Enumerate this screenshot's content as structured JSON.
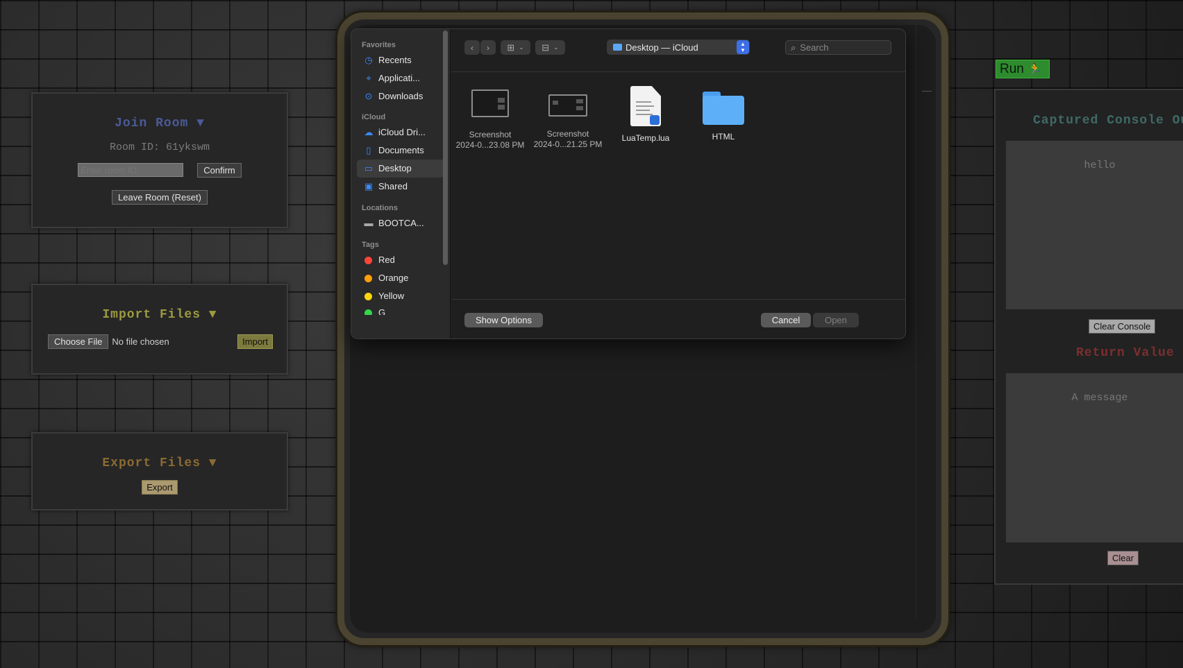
{
  "join_room": {
    "title": "Join Room ▼",
    "room_id_label": "Room ID: 61ykswm",
    "input_placeholder": "Enter room ID",
    "confirm_label": "Confirm",
    "leave_label": "Leave Room (Reset)"
  },
  "import_files": {
    "title": "Import Files ▼",
    "choose_file_label": "Choose File",
    "file_status": "No file chosen",
    "import_label": "Import"
  },
  "export_files": {
    "title": "Export Files ▼",
    "export_label": "Export"
  },
  "dialog": {
    "sidebar": {
      "favorites_heading": "Favorites",
      "favorites": [
        {
          "label": "Recents",
          "icon": "clock-icon"
        },
        {
          "label": "Applicati...",
          "icon": "applications-icon"
        },
        {
          "label": "Downloads",
          "icon": "download-icon"
        }
      ],
      "icloud_heading": "iCloud",
      "icloud": [
        {
          "label": "iCloud Dri...",
          "icon": "cloud-icon"
        },
        {
          "label": "Documents",
          "icon": "document-icon"
        },
        {
          "label": "Desktop",
          "icon": "desktop-icon"
        },
        {
          "label": "Shared",
          "icon": "shared-folder-icon"
        }
      ],
      "locations_heading": "Locations",
      "locations": [
        {
          "label": "BOOTCA...",
          "icon": "disk-icon"
        }
      ],
      "tags_heading": "Tags",
      "tags": [
        {
          "label": "Red",
          "color": "#ff453a"
        },
        {
          "label": "Orange",
          "color": "#ff9f0a"
        },
        {
          "label": "Yellow",
          "color": "#ffd60a"
        },
        {
          "label": "G",
          "color": "#32d74b"
        }
      ]
    },
    "location": "Desktop — iCloud",
    "search_placeholder": "Search",
    "files": [
      {
        "name_line1": "Screenshot",
        "name_line2": "2024-0...23.08 PM",
        "icon": "screenshot-icon"
      },
      {
        "name_line1": "Screenshot",
        "name_line2": "2024-0...21.25 PM",
        "icon": "screenshot-icon"
      },
      {
        "name_line1": "LuaTemp.lua",
        "name_line2": "",
        "icon": "lua-file-icon"
      },
      {
        "name_line1": "HTML",
        "name_line2": "",
        "icon": "folder-icon"
      }
    ],
    "show_options_label": "Show Options",
    "cancel_label": "Cancel",
    "open_label": "Open"
  },
  "run_button_label": "Run",
  "console": {
    "title": "Captured Console Ou",
    "output": "hello",
    "clear_console_label": "Clear Console",
    "return_title": "Return Value",
    "return_output": "A message",
    "clear_label": "Clear"
  },
  "colors": {
    "join_title": "#4a5b98",
    "import_title": "#9d9a40",
    "export_title": "#8c6b33",
    "console_title": "#3f6a66",
    "return_title": "#7b2f2f",
    "run_bg": "#2e8b2e",
    "accent_blue": "#3c6ee6"
  }
}
